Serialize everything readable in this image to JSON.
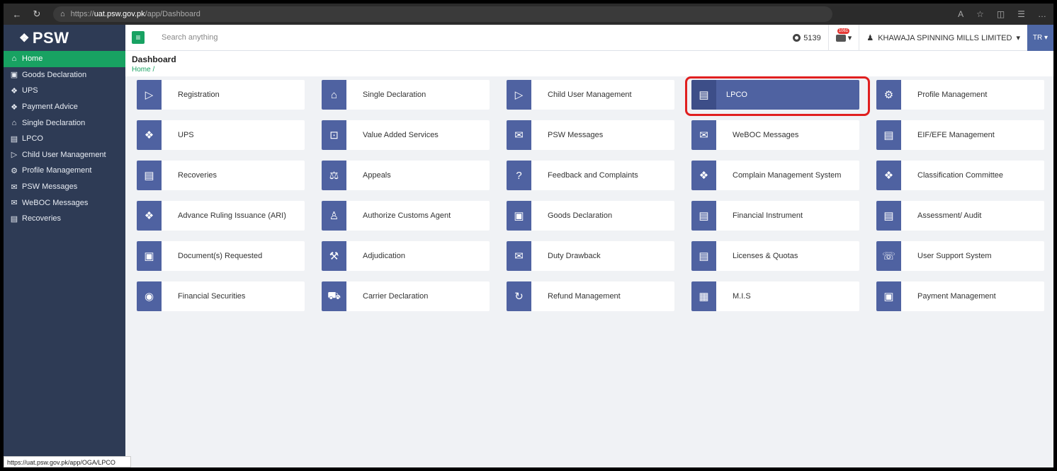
{
  "browser": {
    "url_prefix": "https://",
    "url_host": "uat.psw.gov.pk",
    "url_path": "/app/Dashboard"
  },
  "sidebar": {
    "logo": "PSW",
    "items": [
      {
        "label": "Home",
        "icon": "home-icon",
        "active": true
      },
      {
        "label": "Goods Declaration",
        "icon": "goods-icon"
      },
      {
        "label": "UPS",
        "icon": "ups-icon"
      },
      {
        "label": "Payment Advice",
        "icon": "payment-icon"
      },
      {
        "label": "Single Declaration",
        "icon": "building-icon"
      },
      {
        "label": "LPCO",
        "icon": "doc-icon"
      },
      {
        "label": "Child User Management",
        "icon": "child-user-icon"
      },
      {
        "label": "Profile Management",
        "icon": "profile-icon"
      },
      {
        "label": "PSW Messages",
        "icon": "message-icon"
      },
      {
        "label": "WeBOC Messages",
        "icon": "weboc-icon"
      },
      {
        "label": "Recoveries",
        "icon": "recoveries-icon"
      }
    ],
    "status_url": "https://uat.psw.gov.pk/app/OGA/LPCO"
  },
  "header": {
    "search_placeholder": "Search anything",
    "points": "5139",
    "msg_badge": "1061",
    "company": "KHAWAJA SPINNING MILLS LIMITED",
    "user_initials": "TR"
  },
  "page": {
    "title": "Dashboard",
    "breadcrumb": "Home /"
  },
  "tiles": [
    {
      "label": "Registration",
      "icon": "▷"
    },
    {
      "label": "Single Declaration",
      "icon": "⌂"
    },
    {
      "label": "Child User Management",
      "icon": "▷"
    },
    {
      "label": "LPCO",
      "icon": "▤"
    },
    {
      "label": "Profile Management",
      "icon": "⚙"
    },
    {
      "label": "UPS",
      "icon": "❖"
    },
    {
      "label": "Value Added Services",
      "icon": "⊡"
    },
    {
      "label": "PSW Messages",
      "icon": "✉"
    },
    {
      "label": "WeBOC Messages",
      "icon": "✉"
    },
    {
      "label": "EIF/EFE Management",
      "icon": "▤"
    },
    {
      "label": "Recoveries",
      "icon": "▤"
    },
    {
      "label": "Appeals",
      "icon": "⚖"
    },
    {
      "label": "Feedback and Complaints",
      "icon": "?"
    },
    {
      "label": "Complain Management System",
      "icon": "❖"
    },
    {
      "label": "Classification Committee",
      "icon": "❖"
    },
    {
      "label": "Advance Ruling Issuance (ARI)",
      "icon": "❖"
    },
    {
      "label": "Authorize Customs Agent",
      "icon": "♙"
    },
    {
      "label": "Goods Declaration",
      "icon": "▣"
    },
    {
      "label": "Financial Instrument",
      "icon": "▤"
    },
    {
      "label": "Assessment/ Audit",
      "icon": "▤"
    },
    {
      "label": "Document(s) Requested",
      "icon": "▣"
    },
    {
      "label": "Adjudication",
      "icon": "⚒"
    },
    {
      "label": "Duty Drawback",
      "icon": "✉"
    },
    {
      "label": "Licenses & Quotas",
      "icon": "▤"
    },
    {
      "label": "User Support System",
      "icon": "☏"
    },
    {
      "label": "Financial Securities",
      "icon": "◉"
    },
    {
      "label": "Carrier Declaration",
      "icon": "⛟"
    },
    {
      "label": "Refund Management",
      "icon": "↻"
    },
    {
      "label": "M.I.S",
      "icon": "▦"
    },
    {
      "label": "Payment Management",
      "icon": "▣"
    }
  ],
  "highlighted_tile": "LPCO"
}
